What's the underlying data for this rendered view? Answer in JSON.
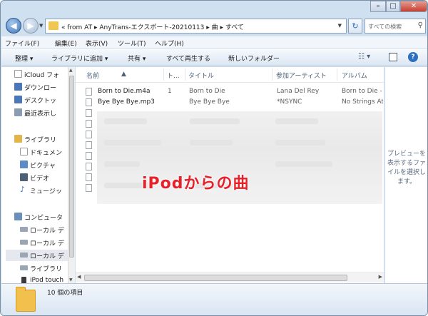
{
  "window": {
    "controls": {
      "minimize": "–",
      "maximize": "□",
      "close": "✕"
    }
  },
  "nav": {
    "back": "◀",
    "forward": "▶",
    "refresh": "↻"
  },
  "address": {
    "path": "« from AT ▸ AnyTrans-エクスポート-20210113 ▸ 曲 ▸ すべて"
  },
  "search": {
    "placeholder": "すべての検索"
  },
  "menubar": [
    "ファイル(F)",
    "編集(E)",
    "表示(V)",
    "ツール(T)",
    "ヘルプ(H)"
  ],
  "toolbar": {
    "organize": "整理 ▾",
    "add_library": "ライブラリに追加 ▾",
    "share": "共有 ▾",
    "play_all": "すべて再生する",
    "new_folder": "新しいフォルダー",
    "help": "?"
  },
  "navpane": {
    "items": [
      {
        "label": "iCloud フォ",
        "color": "#c9d4e0"
      },
      {
        "label": "ダウンロー",
        "color": "#4a77b8"
      },
      {
        "label": "デスクトッ",
        "color": "#4a77b8"
      },
      {
        "label": "最近表示し",
        "color": "#8c9cb0"
      },
      {
        "label": "ライブラリ",
        "color": "#e3b449"
      },
      {
        "label": "ドキュメン",
        "color": "#dfe5ee"
      },
      {
        "label": "ピクチャ",
        "color": "#5c8bc6"
      },
      {
        "label": "ビデオ",
        "color": "#4d6075"
      },
      {
        "label": "ミュージッ",
        "color": "#3a76c0"
      },
      {
        "label": "コンピュータ",
        "color": "#6a8fb9"
      },
      {
        "label": "ローカル デ",
        "color": "#9aa6b3"
      },
      {
        "label": "ローカル デ",
        "color": "#9aa6b3"
      },
      {
        "label": "ローカル デ",
        "color": "#9aa6b3"
      },
      {
        "label": "ライブラリ",
        "color": "#9aa6b3"
      },
      {
        "label": "iPod touch",
        "color": "#3c3c3c"
      }
    ]
  },
  "columns": {
    "name": "名前",
    "track": "ト...",
    "title": "タイトル",
    "artist": "参加アーティスト",
    "album": "アルバム"
  },
  "files": [
    {
      "name": "Born to Die.m4a",
      "track": "1",
      "title": "Born to Die",
      "artist": "Lana Del Rey",
      "album": "Born to Die -"
    },
    {
      "name": "Bye Bye Bye.mp3",
      "track": "",
      "title": "Bye Bye Bye",
      "artist": "*NSYNC",
      "album": "No Strings Att"
    }
  ],
  "overlay_text": "iPodからの曲",
  "preview": {
    "text": "プレビューを表示するファイルを選択します。"
  },
  "status": {
    "count": "10 個の項目"
  }
}
